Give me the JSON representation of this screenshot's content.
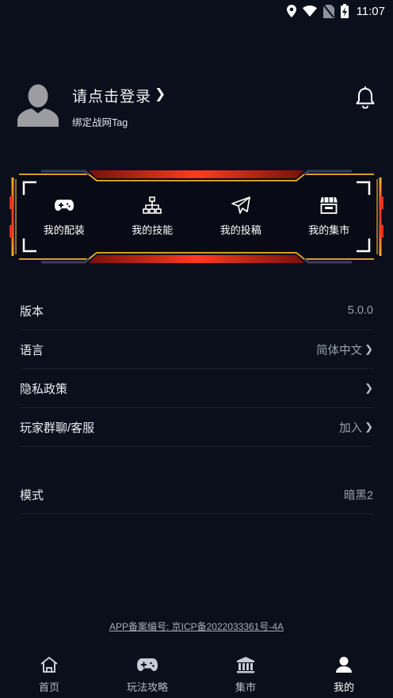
{
  "status_bar": {
    "time": "11:07",
    "icons": [
      "location-icon",
      "wifi-icon",
      "no-sim-icon",
      "battery-charging-icon"
    ]
  },
  "profile": {
    "login_text": "请点击登录",
    "chevron": "❯",
    "bind_text": "绑定战网Tag",
    "avatar_icon": "user-avatar-icon",
    "notification_icon": "bell-icon"
  },
  "quick_actions": [
    {
      "label": "我的配装",
      "icon": "gamepad-icon"
    },
    {
      "label": "我的技能",
      "icon": "sitemap-icon"
    },
    {
      "label": "我的投稿",
      "icon": "paper-plane-icon"
    },
    {
      "label": "我的集市",
      "icon": "store-icon"
    }
  ],
  "settings": [
    {
      "label": "版本",
      "value": "5.0.0",
      "arrow": ""
    },
    {
      "label": "语言",
      "value": "简体中文",
      "arrow": "❯"
    },
    {
      "label": "隐私政策",
      "value": "",
      "arrow": "❯"
    },
    {
      "label": "玩家群聊/客服",
      "value": "加入",
      "arrow": "❯"
    }
  ],
  "mode": {
    "label": "模式",
    "value": "暗黑2"
  },
  "icp_text": "APP备案编号: 京ICP备2022033361号-4A",
  "tabs": [
    {
      "label": "首页",
      "icon": "home-icon",
      "active": false
    },
    {
      "label": "玩法攻略",
      "icon": "gamepad-icon",
      "active": false
    },
    {
      "label": "集市",
      "icon": "bank-icon",
      "active": false
    },
    {
      "label": "我的",
      "icon": "person-icon",
      "active": true
    }
  ],
  "colors": {
    "background": "#0b0f1c",
    "accent_red": "#e8321f",
    "accent_gold": "#f2b12c",
    "divider": "#1c2130"
  }
}
